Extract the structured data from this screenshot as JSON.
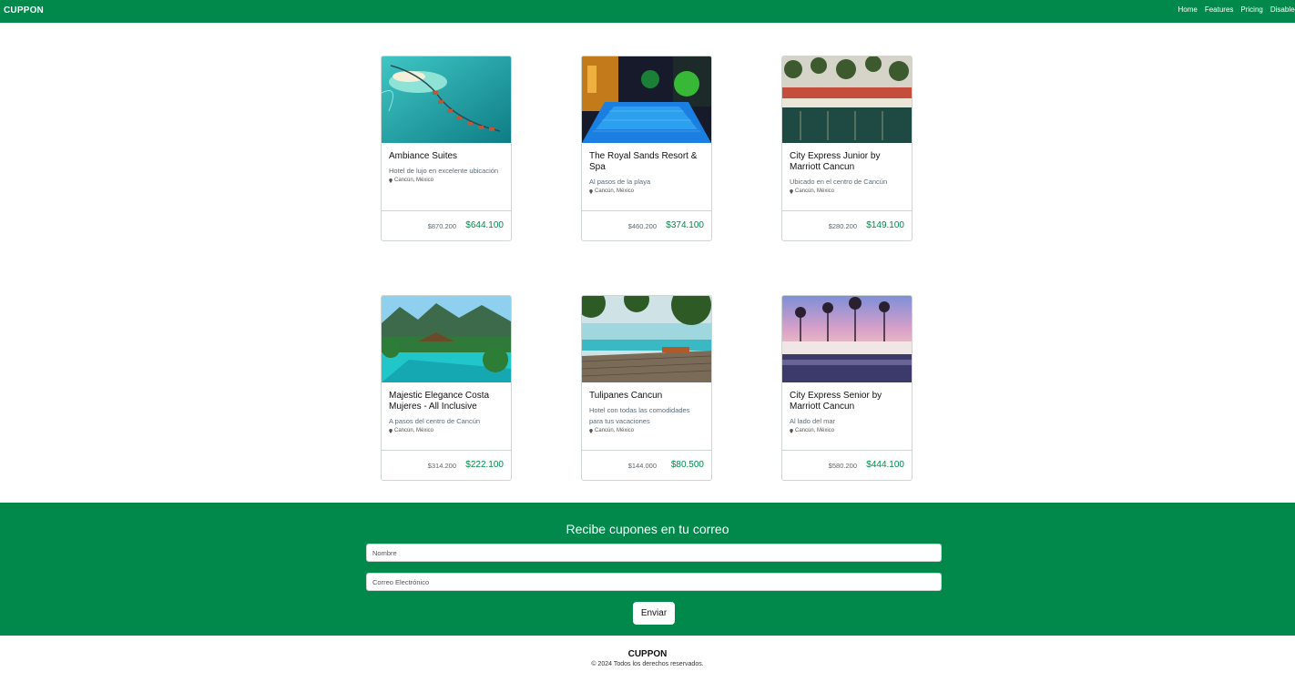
{
  "navbar": {
    "brand": "CUPPON",
    "links": [
      "Home",
      "Features",
      "Pricing",
      "Disabled"
    ]
  },
  "hotels": [
    {
      "title": "Ambiance Suites",
      "description": "Hotel de lujo en excelente ubicación",
      "location": "Cancún, México",
      "old_price": "$870.200",
      "price": "$644.100",
      "image": "overwater-bungalows-lagoon"
    },
    {
      "title": "The Royal Sands Resort & Spa",
      "description": "Al pasos de la playa",
      "location": "Cancún, México",
      "old_price": "$460.200",
      "price": "$374.100",
      "image": "night-pool-neon-lights"
    },
    {
      "title": "City Express Junior by Marriott Cancun",
      "description": "Ubicado en el centro de Cancún",
      "location": "Cancún, México",
      "old_price": "$280.200",
      "price": "$149.100",
      "image": "palm-pool-loungers"
    },
    {
      "title": "Majestic Elegance Costa Mujeres - All Inclusive",
      "description": "A pasos del centro de Cancún",
      "location": "Cancún, México",
      "old_price": "$314.200",
      "price": "$222.100",
      "image": "tropical-jungle-pool"
    },
    {
      "title": "Tulipanes Cancun",
      "description": "Hotel con todas las comodidades para tus vacaciones",
      "location": "Cancún, México",
      "old_price": "$144.000",
      "price": "$80.500",
      "image": "infinity-pool-deck"
    },
    {
      "title": "City Express Senior by Marriott Cancun",
      "description": "Al lado del mar",
      "location": "Cancún, México",
      "old_price": "$580.200",
      "price": "$444.100",
      "image": "sunset-palm-pool"
    }
  ],
  "newsletter": {
    "title": "Recibe cupones en tu correo",
    "name_placeholder": "Nombre",
    "email_placeholder": "Correo Electrónico",
    "submit_label": "Enviar"
  },
  "footer": {
    "brand": "CUPPON",
    "copyright": "© 2024 Todos los derechos reservados."
  },
  "colors": {
    "accent": "#00894b",
    "price": "#00894b",
    "text": "#111111"
  },
  "icons": {
    "location": "map-pin-icon"
  }
}
